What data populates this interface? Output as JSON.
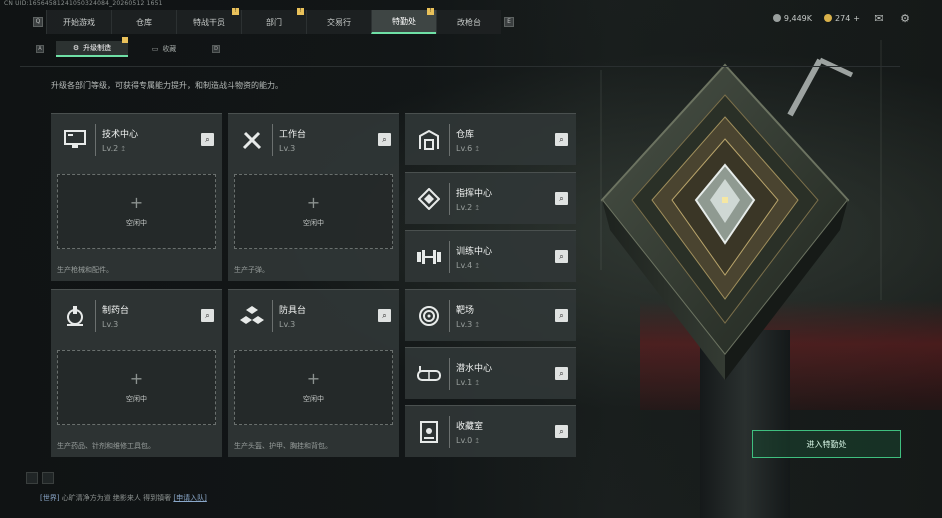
{
  "uid": "CN UID:16564581241050324084_20260512 1651",
  "nav": {
    "tabs": [
      {
        "label": "开始游戏",
        "badge": ""
      },
      {
        "label": "仓库",
        "badge": ""
      },
      {
        "label": "特战干员",
        "badge": "!"
      },
      {
        "label": "部门",
        "badge": "!"
      },
      {
        "label": "交易行",
        "badge": ""
      },
      {
        "label": "特勤处",
        "badge": "!"
      },
      {
        "label": "改枪台",
        "badge": ""
      }
    ],
    "left_key": "Q",
    "right_key": "E",
    "active_index": 5
  },
  "currency": {
    "silver": "9,449K",
    "gold": "274",
    "gold_plus": "+"
  },
  "subtabs": {
    "left_key": "A",
    "right_key": "D",
    "items": [
      {
        "label": "升级制造",
        "badge": "!"
      },
      {
        "label": "收藏",
        "badge": ""
      }
    ],
    "active_index": 0
  },
  "description": "升级各部门等级，可获得专属能力提升，和制造战斗物资的能力。",
  "production_cards": [
    {
      "title": "技术中心",
      "level": "Lv.2",
      "icon": "computer-icon",
      "slot_text": "空闲中",
      "note": "生产枪械和配件。"
    },
    {
      "title": "工作台",
      "level": "Lv.3",
      "icon": "tools-icon",
      "slot_text": "空闲中",
      "note": "生产子弹。"
    },
    {
      "title": "制药台",
      "level": "Lv.3",
      "icon": "microscope-icon",
      "slot_text": "空闲中",
      "note": "生产药品、针剂和维修工具包。"
    },
    {
      "title": "防具台",
      "level": "Lv.3",
      "icon": "armor-icon",
      "slot_text": "空闲中",
      "note": "生产头盔、护甲、胸挂和背包。"
    }
  ],
  "side_cards": [
    {
      "title": "仓库",
      "level": "Lv.6",
      "icon": "warehouse-icon"
    },
    {
      "title": "指挥中心",
      "level": "Lv.2",
      "icon": "command-icon"
    },
    {
      "title": "训练中心",
      "level": "Lv.4",
      "icon": "dumbbell-icon"
    },
    {
      "title": "靶场",
      "level": "Lv.3",
      "icon": "target-icon"
    },
    {
      "title": "潜水中心",
      "level": "Lv.1",
      "icon": "diving-mask-icon"
    },
    {
      "title": "收藏室",
      "level": "Lv.0",
      "icon": "collection-icon"
    }
  ],
  "level_mark": "↥",
  "search_glyph": "🔍",
  "enter_button": "进入特勤处",
  "chat": {
    "channel": "[世界]",
    "message": "心旷清净方为道  绝影来人 得到镇奢",
    "link": "[申请入队]"
  },
  "colors": {
    "accent": "#6fe0a6",
    "badge": "#e9c15a",
    "card_bg": "#303636"
  }
}
